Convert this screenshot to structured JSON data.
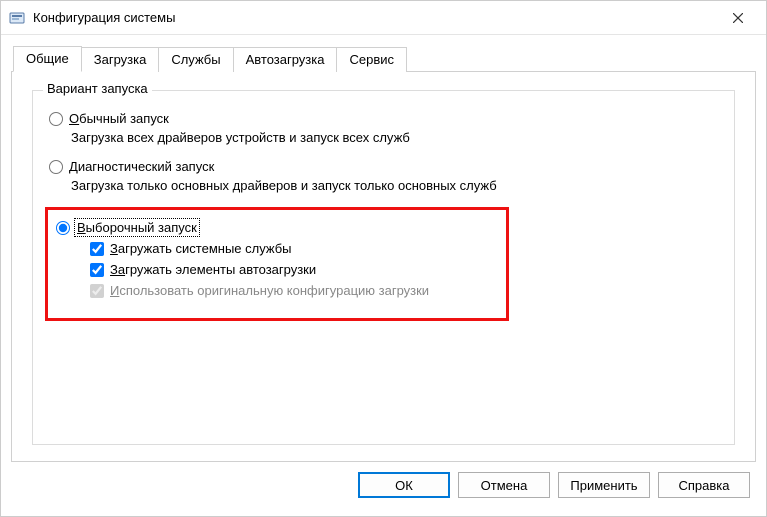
{
  "window": {
    "title": "Конфигурация системы"
  },
  "tabs": {
    "general": "Общие",
    "boot": "Загрузка",
    "services": "Службы",
    "startup": "Автозагрузка",
    "tools": "Сервис"
  },
  "group": {
    "legend": "Вариант запуска"
  },
  "normal": {
    "label_prefix": "О",
    "label_rest": "бычный запуск",
    "desc": "Загрузка всех драйверов устройств и запуск всех служб"
  },
  "diagnostic": {
    "label_prefix": "Д",
    "label_rest": "иагностический запуск",
    "desc": "Загрузка только основных драйверов и запуск только основных служб"
  },
  "selective": {
    "label_prefix": "В",
    "label_rest": "ыборочный запуск",
    "load_services_prefix": "З",
    "load_services_rest": "агружать системные службы",
    "load_startup_prefix": "За",
    "load_startup_rest": "гружать элементы автозагрузки",
    "original_cfg_prefix": "И",
    "original_cfg_rest": "спользовать оригинальную конфигурацию загрузки"
  },
  "buttons": {
    "ok": "ОК",
    "cancel": "Отмена",
    "apply": "Применить",
    "help": "Справка"
  }
}
